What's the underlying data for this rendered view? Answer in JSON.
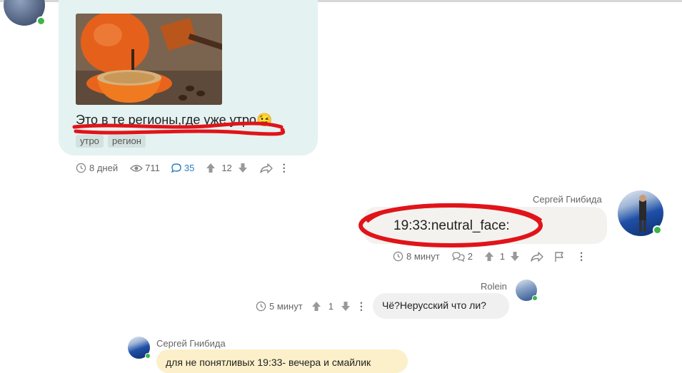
{
  "post": {
    "text": "Это в те регионы,где уже утро",
    "emoji": "😉",
    "tags": [
      "утро",
      "регион"
    ],
    "meta": {
      "time": "8 дней",
      "views": "711",
      "comments": "35",
      "votes": "12"
    }
  },
  "message1": {
    "author": "Сергей Гнибида",
    "text": "19:33:neutral_face:",
    "meta": {
      "time": "8 минут",
      "replies": "2",
      "votes": "1"
    }
  },
  "message2": {
    "author": "Rolein",
    "text": "Чё?Нерусский что ли?",
    "meta": {
      "time": "5 минут",
      "votes": "1"
    }
  },
  "message3": {
    "author": "Сергей Гнибида",
    "text": "для не понятливых 19:33- вечера и смайлик"
  },
  "colors": {
    "post_bg": "#e4f3f1",
    "bubble_grey": "#f0f0f0",
    "bubble_yellow": "#fbf0c9",
    "accent_blue": "#2a7fc1",
    "online_green": "#3cb54a",
    "annotation_red": "#e0141a"
  },
  "icons": [
    "clock-icon",
    "eye-icon",
    "comment-icon",
    "upvote-icon",
    "downvote-icon",
    "share-icon",
    "more-icon",
    "flag-icon",
    "replies-icon"
  ]
}
